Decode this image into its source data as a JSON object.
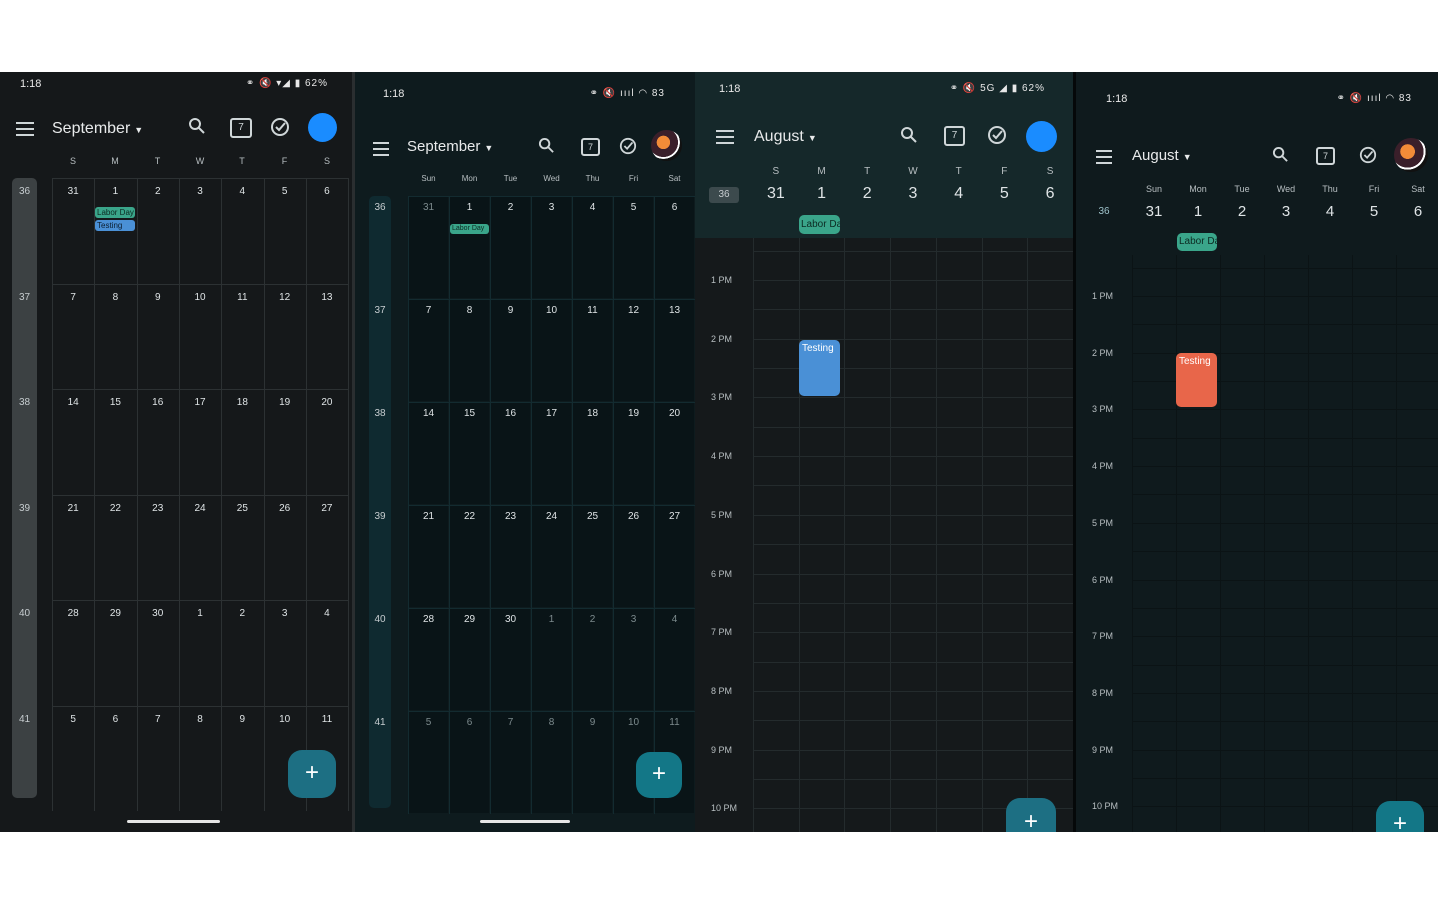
{
  "screens": [
    {
      "status_time": "1:18",
      "status_icons": "⚭ 🔇 ▾◢ ▮ 62%",
      "month": "September",
      "days": [
        "S",
        "M",
        "T",
        "W",
        "T",
        "F",
        "S"
      ],
      "weeks": [
        {
          "n": "36",
          "d": [
            "31",
            "1",
            "2",
            "3",
            "4",
            "5",
            "6"
          ]
        },
        {
          "n": "37",
          "d": [
            "7",
            "8",
            "9",
            "10",
            "11",
            "12",
            "13"
          ]
        },
        {
          "n": "38",
          "d": [
            "14",
            "15",
            "16",
            "17",
            "18",
            "19",
            "20"
          ]
        },
        {
          "n": "39",
          "d": [
            "21",
            "22",
            "23",
            "24",
            "25",
            "26",
            "27"
          ]
        },
        {
          "n": "40",
          "d": [
            "28",
            "29",
            "30",
            "1",
            "2",
            "3",
            "4"
          ]
        },
        {
          "n": "41",
          "d": [
            "5",
            "6",
            "7",
            "8",
            "9",
            "10",
            "11"
          ]
        }
      ],
      "events": [
        "Labor Day",
        "Testing"
      ]
    },
    {
      "status_time": "1:18",
      "status_icons": "⚭ 🔇 ıııl ◠ 83",
      "month": "September",
      "days": [
        "Sun",
        "Mon",
        "Tue",
        "Wed",
        "Thu",
        "Fri",
        "Sat"
      ],
      "weeks": [
        {
          "n": "36",
          "d": [
            "31",
            "1",
            "2",
            "3",
            "4",
            "5",
            "6"
          ]
        },
        {
          "n": "37",
          "d": [
            "7",
            "8",
            "9",
            "10",
            "11",
            "12",
            "13"
          ]
        },
        {
          "n": "38",
          "d": [
            "14",
            "15",
            "16",
            "17",
            "18",
            "19",
            "20"
          ]
        },
        {
          "n": "39",
          "d": [
            "21",
            "22",
            "23",
            "24",
            "25",
            "26",
            "27"
          ]
        },
        {
          "n": "40",
          "d": [
            "28",
            "29",
            "30",
            "1",
            "2",
            "3",
            "4"
          ]
        },
        {
          "n": "41",
          "d": [
            "5",
            "6",
            "7",
            "8",
            "9",
            "10",
            "11"
          ]
        }
      ],
      "events": [
        "Labor Day"
      ]
    },
    {
      "status_time": "1:18",
      "status_icons": "⚭ 🔇 5G ◢ ▮ 62%",
      "month": "August",
      "week_num": "36",
      "days": [
        "S",
        "M",
        "T",
        "W",
        "T",
        "F",
        "S"
      ],
      "dates": [
        "31",
        "1",
        "2",
        "3",
        "4",
        "5",
        "6"
      ],
      "allday": "Labor Da",
      "times": [
        "1 PM",
        "2 PM",
        "3 PM",
        "4 PM",
        "5 PM",
        "6 PM",
        "7 PM",
        "8 PM",
        "9 PM",
        "10 PM"
      ],
      "event": "Testing"
    },
    {
      "status_time": "1:18",
      "status_icons": "⚭ 🔇 ıııl ◠ 83",
      "month": "August",
      "week_num": "36",
      "days": [
        "Sun",
        "Mon",
        "Tue",
        "Wed",
        "Thu",
        "Fri",
        "Sat"
      ],
      "dates": [
        "31",
        "1",
        "2",
        "3",
        "4",
        "5",
        "6"
      ],
      "allday": "Labor Da",
      "times": [
        "1 PM",
        "2 PM",
        "3 PM",
        "4 PM",
        "5 PM",
        "6 PM",
        "7 PM",
        "8 PM",
        "9 PM",
        "10 PM"
      ],
      "event": "Testing"
    }
  ],
  "colors": {
    "s1_bg": "#15181a",
    "s2_bg": "#0e1b1e",
    "s3_bg": "#15191b",
    "s4_bg": "#0f1a1d",
    "labor_chip": "#3aa58a",
    "testing_blue": "#4a90d6",
    "testing_orange": "#e8664a",
    "fab_teal": "#1d6f83",
    "avatar_blue": "#1a8cff"
  },
  "icons": [
    "menu-icon",
    "search-icon",
    "calendar-today-icon",
    "tasks-check-icon",
    "add-icon"
  ],
  "today_icon_label": "7",
  "fab_label": "+"
}
